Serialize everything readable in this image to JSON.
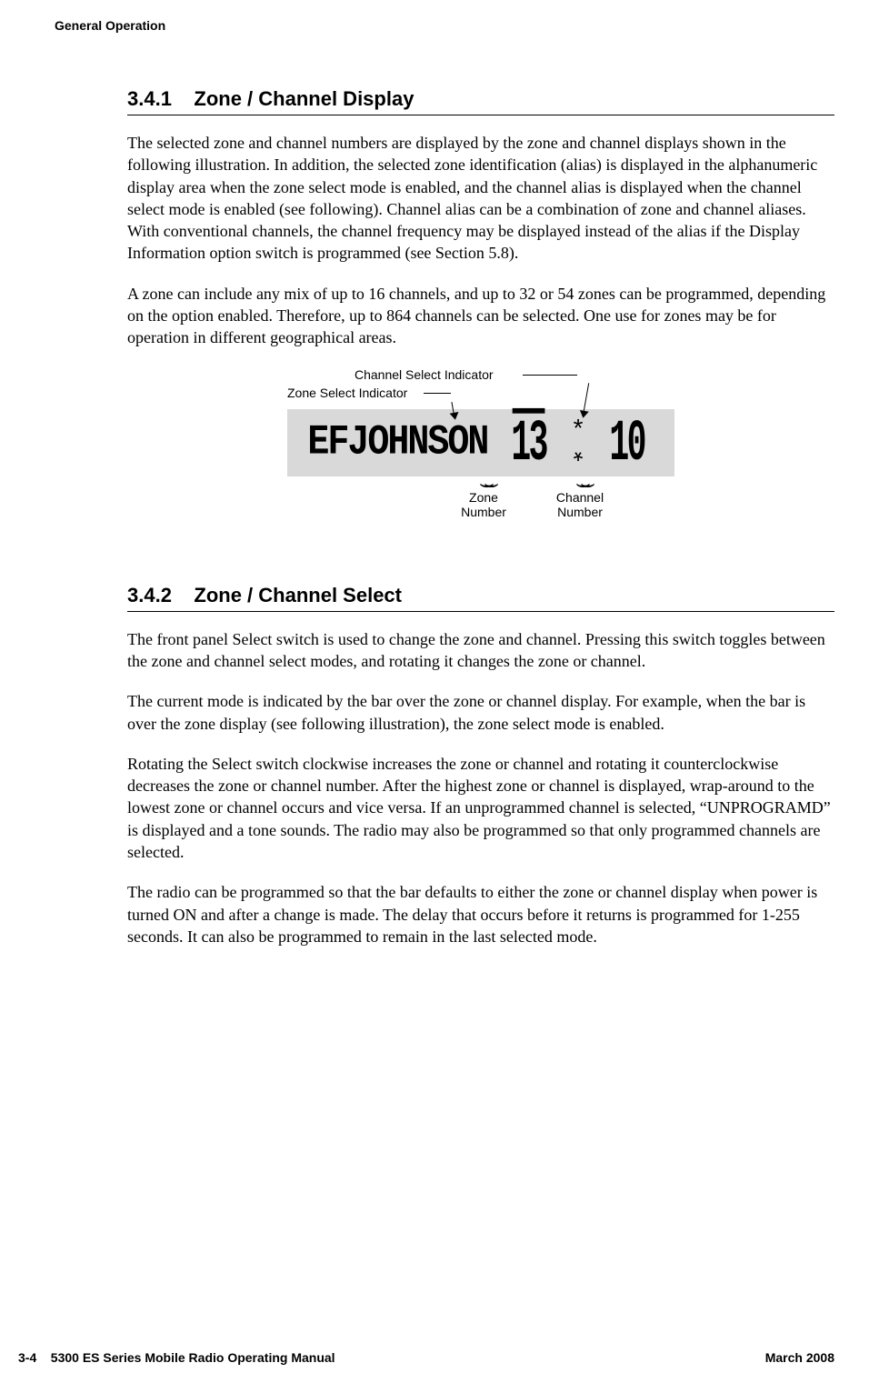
{
  "running_header": "General Operation",
  "section_341": {
    "number": "3.4.1",
    "title": "Zone / Channel Display",
    "p1": "The selected zone and channel numbers are displayed by the zone and channel displays shown in the following illustration. In addition, the selected zone identification (alias) is displayed in the alphanumeric display area when the zone select mode is enabled, and the channel alias is displayed when the channel select mode is enabled (see following). Channel alias can be a combination of zone and channel aliases. With conventional channels, the channel frequency may be displayed instead of the alias if the Display Information option switch is programmed (see Section 5.8).",
    "p2": "A zone can include any mix of up to 16 channels, and up to 32 or 54 zones can be programmed, depending on the option enabled. Therefore, up to 864 channels can be selected. One use for zones may be for operation in different geographical areas."
  },
  "figure": {
    "channel_select_indicator_label": "Channel Select Indicator",
    "zone_select_indicator_label": "Zone Select Indicator",
    "lcd_text": "EFJOHNSON",
    "zone_number_value": "13",
    "channel_number_value": "10",
    "zone_number_label_line1": "Zone",
    "zone_number_label_line2": "Number",
    "channel_number_label_line1": "Channel",
    "channel_number_label_line2": "Number"
  },
  "section_342": {
    "number": "3.4.2",
    "title": "Zone / Channel Select",
    "p1": "The front panel Select switch is used to change the zone and channel. Pressing this switch toggles between the zone and channel select modes, and rotating it changes the zone or channel.",
    "p2": "The current mode is indicated by the bar over the zone or channel display. For example, when the bar is over the zone display (see following illustration), the zone select mode is enabled.",
    "p3": "Rotating the Select switch clockwise increases the zone or channel and rotating it counterclockwise decreases the zone or channel number. After the highest zone or channel is displayed, wrap-around to the lowest zone or channel occurs and vice versa. If an unprogrammed channel is selected, “UNPROGRAMD” is displayed and a tone sounds. The radio may also be programmed so that only programmed channels are selected.",
    "p4": "The radio can be programmed so that the bar defaults to either the zone or channel display when power is turned ON and after a change is made. The delay that occurs before it returns is programmed for 1-255 seconds. It can also be programmed to remain in the last selected mode."
  },
  "footer": {
    "left_page": "3-4",
    "left_title": "5300 ES Series Mobile Radio Operating Manual",
    "right": "March 2008"
  }
}
